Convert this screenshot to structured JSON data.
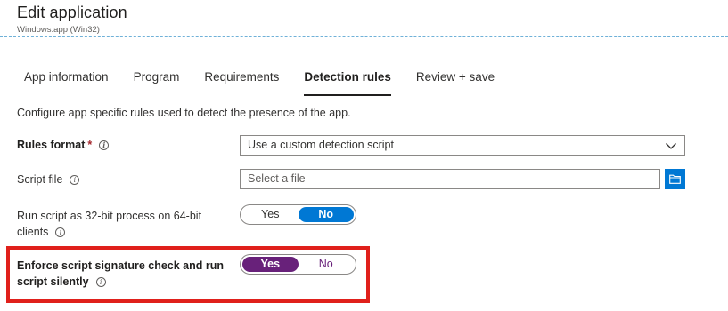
{
  "header": {
    "title": "Edit application",
    "subtitle": "Windows.app (Win32)"
  },
  "tabs": [
    {
      "label": "App information",
      "active": false
    },
    {
      "label": "Program",
      "active": false
    },
    {
      "label": "Requirements",
      "active": false
    },
    {
      "label": "Detection rules",
      "active": true
    },
    {
      "label": "Review + save",
      "active": false
    }
  ],
  "description": "Configure app specific rules used to detect the presence of the app.",
  "form": {
    "rules_format": {
      "label": "Rules format",
      "required_mark": "*",
      "value": "Use a custom detection script"
    },
    "script_file": {
      "label": "Script file",
      "placeholder": "Select a file"
    },
    "run_32bit": {
      "label_line1": "Run script as 32-bit process on 64-bit",
      "label_line2": "clients",
      "yes_label": "Yes",
      "no_label": "No",
      "selected": "No"
    },
    "enforce_signature": {
      "label_line1": "Enforce script signature check and run",
      "label_line2": "script silently",
      "yes_label": "Yes",
      "no_label": "No",
      "selected": "Yes"
    }
  },
  "icons": {
    "info": "info-icon",
    "dropdown": "chevron-down-icon",
    "browse": "folder-icon"
  },
  "colors": {
    "accent_blue": "#0078d4",
    "toggle_purple": "#68217a",
    "highlight_red": "#e0201b",
    "required_red": "#a4262c"
  }
}
